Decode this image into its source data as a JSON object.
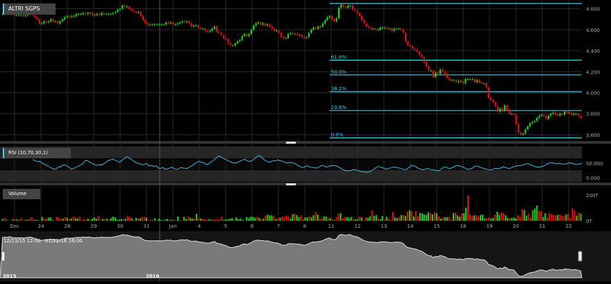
{
  "chart_data": [
    {
      "type": "candlestick",
      "title": "ALTRI SGPS",
      "yticks": [
        "4.800",
        "4.600",
        "4.400",
        "4.200",
        "4.000",
        "3.800",
        "3.600"
      ],
      "ylim": [
        3.56,
        4.87
      ],
      "fibonacci": {
        "levels": [
          "61.8%",
          "50.0%",
          "38.2%",
          "23.6%",
          "0.0%"
        ],
        "values": [
          4.31,
          4.17,
          4.01,
          3.83,
          3.57
        ],
        "top": 4.85
      },
      "x": [
        1,
        2,
        3,
        4,
        5,
        6,
        7,
        8,
        9,
        10,
        11,
        12,
        13,
        14,
        15,
        16,
        17,
        18,
        19,
        20,
        21,
        22,
        23,
        24,
        25,
        26,
        27,
        28,
        29,
        30,
        31,
        32,
        33,
        34,
        35,
        36,
        37,
        38,
        39,
        40,
        41,
        42,
        43,
        44,
        45,
        46,
        47,
        48,
        49,
        50,
        51,
        52,
        53,
        54,
        55,
        56,
        57,
        58,
        59,
        60,
        61,
        62,
        63,
        64,
        65,
        66,
        67,
        68,
        69,
        70,
        71,
        72,
        73,
        74,
        75,
        76,
        77,
        78,
        79,
        80,
        81,
        82,
        83,
        84,
        85,
        86,
        87,
        88,
        89,
        90,
        91,
        92,
        93,
        94,
        95,
        96,
        97,
        98,
        99,
        100,
        101,
        102,
        103,
        104,
        105,
        106,
        107,
        108,
        109,
        110,
        111,
        112,
        113,
        114,
        115,
        116,
        117,
        118,
        119,
        120,
        121,
        122,
        123,
        124,
        125,
        126,
        127,
        128,
        129,
        130,
        131,
        132,
        133,
        134,
        135,
        136,
        137,
        138,
        139,
        140,
        141,
        142,
        143,
        144,
        145,
        146,
        147,
        148,
        149,
        150,
        151,
        152,
        153,
        154,
        155,
        156,
        157,
        158,
        159,
        160,
        161,
        162,
        163,
        164,
        165,
        166,
        167,
        168,
        169,
        170,
        171,
        172,
        173,
        174,
        175,
        176,
        177,
        178,
        179,
        180,
        181,
        182,
        183,
        184,
        185,
        186,
        187,
        188,
        189,
        190,
        191,
        192,
        193,
        194,
        195,
        196,
        197,
        198,
        199,
        200,
        201,
        202,
        203,
        204,
        205,
        206,
        207,
        208,
        209,
        210,
        211,
        212,
        213,
        214,
        215,
        216,
        217,
        218,
        219,
        220,
        221,
        222,
        223,
        224,
        225,
        226,
        227,
        228,
        229,
        230,
        231,
        232,
        233,
        234,
        235,
        236,
        237,
        238,
        239,
        240,
        241,
        242,
        243,
        244,
        245,
        246,
        247,
        248,
        249,
        250,
        251,
        252,
        253,
        254,
        255,
        256,
        257,
        258,
        259,
        260,
        261,
        262,
        263,
        264,
        265,
        266,
        267,
        268,
        269,
        270,
        271,
        272,
        273,
        274,
        275,
        276,
        277,
        278,
        279,
        280,
        281,
        282,
        283,
        284,
        285,
        286,
        287,
        288,
        289,
        290,
        291,
        292,
        293,
        294,
        295,
        296,
        297,
        298
      ],
      "close": [
        4.75,
        4.76,
        4.75,
        4.77,
        4.75,
        4.74,
        4.74,
        4.74,
        4.74,
        4.73,
        4.74,
        4.75,
        4.76,
        4.74,
        4.72,
        4.7,
        4.66,
        4.66,
        4.68,
        4.67,
        4.68,
        4.7,
        4.68,
        4.68,
        4.66,
        4.68,
        4.7,
        4.72,
        4.73,
        4.72,
        4.73,
        4.73,
        4.75,
        4.75,
        4.75,
        4.76,
        4.75,
        4.76,
        4.76,
        4.74,
        4.74,
        4.75,
        4.74,
        4.76,
        4.75,
        4.75,
        4.75,
        4.75,
        4.76,
        4.77,
        4.79,
        4.8,
        4.83,
        4.82,
        4.82,
        4.8,
        4.78,
        4.77,
        4.76,
        4.77,
        4.73,
        4.69,
        4.66,
        4.65,
        4.65,
        4.65,
        4.65,
        4.65,
        4.65,
        4.65,
        4.65,
        4.67,
        4.66,
        4.67,
        4.65,
        4.65,
        4.66,
        4.67,
        4.68,
        4.67,
        4.68,
        4.66,
        4.63,
        4.64,
        4.64,
        4.62,
        4.61,
        4.61,
        4.59,
        4.58,
        4.59,
        4.61,
        4.63,
        4.58,
        4.57,
        4.55,
        4.52,
        4.51,
        4.47,
        4.45,
        4.45,
        4.47,
        4.49,
        4.5,
        4.54,
        4.56,
        4.54,
        4.56,
        4.6,
        4.64,
        4.66,
        4.67,
        4.65,
        4.66,
        4.64,
        4.65,
        4.63,
        4.61,
        4.59,
        4.59,
        4.57,
        4.53,
        4.52,
        4.52,
        4.56,
        4.57,
        4.56,
        4.56,
        4.55,
        4.55,
        4.53,
        4.52,
        4.53,
        4.57,
        4.6,
        4.62,
        4.61,
        4.63,
        4.63,
        4.66,
        4.69,
        4.72,
        4.73,
        4.7,
        4.68,
        4.71,
        4.81,
        4.84,
        4.82,
        4.81,
        4.83,
        4.83,
        4.79,
        4.78,
        4.76,
        4.73,
        4.69,
        4.66,
        4.63,
        4.62,
        4.61,
        4.61,
        4.6,
        4.6,
        4.62,
        4.62,
        4.62,
        4.61,
        4.61,
        4.59,
        4.61,
        4.61,
        4.61,
        4.6,
        4.57,
        4.49,
        4.45,
        4.44,
        4.42,
        4.41,
        4.39,
        4.36,
        4.34,
        4.29,
        4.25,
        4.21,
        4.21,
        4.15,
        4.19,
        4.18,
        4.22,
        4.2,
        4.18,
        4.14,
        4.12,
        4.12,
        4.12,
        4.1,
        4.11,
        4.11,
        4.09,
        4.13,
        4.13,
        4.13,
        4.13,
        4.1,
        4.12,
        4.1,
        4.09,
        4.09,
        4.05,
        3.95,
        3.93,
        3.91,
        3.87,
        3.82,
        3.85,
        3.83,
        3.88,
        3.84,
        3.8,
        3.8,
        3.79,
        3.7,
        3.62,
        3.6,
        3.61,
        3.65,
        3.68,
        3.71,
        3.72,
        3.73,
        3.76,
        3.78,
        3.79,
        3.78,
        3.75,
        3.78,
        3.8,
        3.81,
        3.79,
        3.78,
        3.8,
        3.79,
        3.82,
        3.81,
        3.81,
        3.79,
        3.8,
        3.8,
        3.78,
        3.76
      ]
    },
    {
      "type": "line",
      "title": "RSI (10,70,30,1)",
      "yticks": [
        "50.000",
        "0.000"
      ],
      "ylim": [
        0,
        100
      ],
      "values": [
        62,
        60,
        57,
        55,
        57,
        52,
        49,
        45,
        43,
        40,
        36,
        33,
        30,
        30,
        32,
        38,
        37,
        42,
        45,
        43,
        40,
        36,
        30,
        30,
        33,
        37,
        39,
        42,
        45,
        50,
        57,
        60,
        57,
        53,
        50,
        47,
        44,
        43,
        44,
        44,
        44,
        48,
        53,
        57,
        60,
        62,
        64,
        62,
        59,
        56,
        53,
        58,
        63,
        67,
        72,
        70,
        66,
        62,
        58,
        54,
        50,
        49,
        47,
        45,
        45,
        48,
        47,
        40,
        42,
        41,
        38,
        41,
        36,
        32,
        33,
        35,
        30,
        29,
        31,
        33,
        37,
        33,
        30,
        28,
        31,
        35,
        34,
        33,
        32,
        32,
        36,
        39,
        42,
        48,
        51,
        55,
        57,
        52,
        53,
        50,
        45,
        47,
        52,
        56,
        60,
        65,
        70,
        75,
        73,
        69,
        66,
        63,
        60,
        57,
        54,
        52,
        50,
        51,
        53,
        56,
        59,
        62,
        64,
        60,
        57,
        56,
        59,
        62,
        67,
        72,
        76,
        74,
        70,
        63,
        58,
        56,
        53,
        55,
        57,
        58,
        59,
        61,
        59,
        58,
        56,
        53,
        50,
        51,
        53,
        52,
        50,
        49,
        45,
        41,
        38,
        36,
        35,
        39,
        41,
        38,
        36,
        36,
        35,
        33,
        34,
        38,
        41,
        42,
        40,
        37,
        38,
        40,
        42,
        42,
        41,
        40,
        37,
        33,
        30,
        26,
        25,
        24,
        24,
        25,
        27,
        28,
        27,
        25,
        23,
        21,
        21,
        20,
        19,
        19,
        21,
        24,
        28,
        32,
        37,
        39,
        37,
        35,
        33,
        30,
        30,
        32,
        34,
        36,
        37,
        35,
        34,
        33,
        31,
        29,
        28,
        28,
        33,
        37,
        43,
        42,
        40,
        36,
        32,
        30,
        28,
        27,
        30,
        32,
        31,
        28,
        28,
        27,
        25,
        24,
        25,
        30,
        34,
        38,
        36,
        33,
        31,
        34,
        36,
        40,
        42,
        42,
        40,
        38,
        36,
        32,
        30,
        29,
        30,
        33,
        38,
        41,
        40,
        37,
        35,
        33,
        31,
        30,
        28,
        27,
        27,
        30,
        32,
        32,
        30,
        33,
        35,
        38,
        35,
        33,
        32,
        33,
        36,
        38,
        40,
        41,
        42,
        42,
        44,
        46,
        48,
        48,
        46,
        43,
        41,
        38,
        37,
        36,
        37,
        39,
        40,
        43,
        47,
        50,
        52,
        51,
        50,
        48,
        48,
        50,
        48,
        47,
        47,
        48,
        49,
        51,
        50,
        48,
        46,
        45,
        47,
        47,
        50
      ]
    },
    {
      "type": "bar",
      "title": "Volume",
      "yticks": [
        "200T",
        "0T"
      ],
      "ylim": [
        0,
        250
      ],
      "values": [
        15,
        23,
        8,
        3,
        0,
        12,
        15,
        12,
        8,
        21,
        3,
        6,
        8,
        17,
        28,
        8,
        10,
        6,
        0,
        31,
        14,
        17,
        25,
        27,
        7,
        0,
        31,
        24,
        15,
        18,
        26,
        25,
        16,
        18,
        33,
        20,
        19,
        32,
        4,
        14,
        10,
        18,
        7,
        18,
        28,
        16,
        37,
        3,
        16,
        14,
        17,
        9,
        21,
        33,
        28,
        8,
        10,
        15,
        13,
        17,
        39,
        29,
        19,
        6,
        24,
        19,
        19,
        30,
        30,
        24,
        5,
        8,
        6,
        20,
        3,
        16,
        7,
        6,
        8,
        15,
        9,
        8,
        5,
        4,
        34,
        4,
        3,
        31,
        15,
        33,
        22,
        16,
        18,
        56,
        22,
        17,
        15,
        12,
        10,
        14,
        9,
        11,
        11,
        15,
        7,
        32,
        8,
        11,
        11,
        16,
        22,
        11,
        29,
        14,
        19,
        8,
        0,
        30,
        21,
        33,
        30,
        25,
        31,
        22,
        14,
        17,
        40,
        49,
        43,
        42,
        37,
        13,
        24,
        24,
        32,
        32,
        42,
        34,
        18,
        52,
        55,
        45,
        28,
        44,
        14,
        27,
        27,
        36,
        28,
        43,
        69,
        49,
        17,
        19,
        35,
        33,
        23,
        19,
        10,
        7,
        30,
        55,
        61,
        22,
        30,
        30,
        22,
        30,
        15,
        11,
        15,
        33,
        27,
        5,
        27,
        24,
        35,
        81,
        39,
        45,
        20,
        13,
        37,
        12,
        31,
        18,
        7,
        69,
        26,
        21,
        30,
        45,
        45,
        38,
        70,
        83,
        74,
        35,
        75,
        37,
        60,
        58,
        49,
        47,
        66,
        60,
        49,
        69,
        58,
        33,
        17,
        27,
        28,
        28,
        30,
        9,
        60,
        65,
        42,
        33,
        59,
        59,
        103,
        198,
        48,
        39,
        43,
        43,
        34,
        46,
        49,
        20,
        20,
        28,
        19,
        24,
        49,
        72,
        46,
        65,
        60,
        44,
        22,
        23,
        22,
        26,
        19,
        44,
        30,
        92,
        84,
        41,
        58,
        26,
        83,
        97,
        120,
        76,
        75,
        30,
        60,
        28,
        60,
        51,
        47,
        42,
        47,
        49,
        42,
        39,
        50,
        56,
        21,
        97,
        79,
        40,
        62,
        57
      ],
      "up": [
        1,
        0,
        1,
        0,
        1,
        1,
        0,
        1,
        0,
        0,
        1,
        1,
        1,
        0,
        0,
        1,
        0,
        1,
        1,
        1,
        0,
        0,
        1,
        1,
        1,
        1,
        0,
        0,
        0,
        1,
        0,
        1,
        0,
        1,
        0,
        1,
        1,
        0,
        0,
        0,
        0,
        1,
        1,
        1,
        1,
        1,
        0,
        0,
        1,
        0,
        1,
        0,
        1,
        1,
        1,
        1,
        1,
        1,
        0,
        1,
        0,
        0,
        1,
        0,
        1,
        0,
        1,
        0,
        0,
        1,
        0,
        0,
        0,
        1,
        1,
        1,
        1,
        1,
        1,
        1,
        0,
        1,
        1,
        0,
        1,
        0,
        0,
        1,
        1,
        0,
        1,
        1,
        0,
        1,
        0,
        1,
        0,
        0,
        0,
        1,
        1,
        0,
        0,
        0,
        1,
        0,
        1,
        1,
        1,
        1,
        1,
        0,
        1,
        1,
        1,
        1,
        0,
        1,
        1,
        1,
        1,
        1,
        0,
        1,
        0,
        1,
        0,
        1,
        1,
        1,
        0,
        1,
        0,
        1,
        0,
        0,
        0,
        0,
        1,
        1,
        0,
        1,
        1,
        0,
        0,
        1,
        1,
        0,
        1,
        1,
        0,
        1,
        0,
        0,
        1,
        1,
        0,
        1,
        0,
        1,
        0,
        0,
        1,
        0,
        0,
        1,
        1,
        1,
        0,
        1,
        1,
        0,
        1,
        0,
        0,
        1,
        1,
        0,
        1,
        1,
        0,
        1,
        1,
        0,
        1,
        0,
        0,
        0,
        1,
        1,
        0,
        1,
        0,
        1,
        0,
        1,
        0,
        1,
        0,
        0,
        1,
        1,
        1,
        1,
        1,
        0,
        1,
        0,
        1,
        0,
        1,
        0,
        1,
        1,
        0,
        0,
        1,
        0,
        1,
        1,
        0,
        1,
        1,
        0,
        0,
        0,
        1,
        0,
        0,
        1,
        1,
        1,
        0,
        0,
        1,
        1,
        0,
        1,
        1,
        0,
        0,
        1,
        1,
        0,
        1,
        1,
        1,
        0,
        0,
        0,
        1,
        1,
        0,
        0,
        1,
        1,
        1,
        0,
        0,
        1,
        1,
        0,
        0,
        0,
        0,
        0,
        1,
        0,
        0,
        0,
        1,
        0,
        0,
        0,
        0,
        1,
        0,
        1,
        0,
        1,
        0,
        0,
        1,
        1,
        0,
        0,
        0,
        0,
        1,
        1,
        1,
        0,
        1,
        0,
        1,
        0,
        0,
        1,
        0,
        1,
        1,
        0
      ]
    }
  ],
  "xaxis": {
    "labels": [
      "Dec",
      "24",
      "28",
      "29",
      "30",
      "31",
      "Jan",
      "4",
      "5",
      "6",
      "7",
      "8",
      "11",
      "12",
      "13",
      "14",
      "15",
      "18",
      "19",
      "20",
      "21",
      "22"
    ]
  },
  "navigator": {
    "start_label": "12/23/15  12:00",
    "end_label": "01/22/16  16:00",
    "year_labels": [
      "2015",
      "2016"
    ]
  },
  "colors": {
    "up": "#22cc22",
    "down": "#e01010",
    "fib": "#40d0f0",
    "grid": "#2a2a2a",
    "rsi": "#40c8f0",
    "neutral": "#aaaaaa"
  }
}
